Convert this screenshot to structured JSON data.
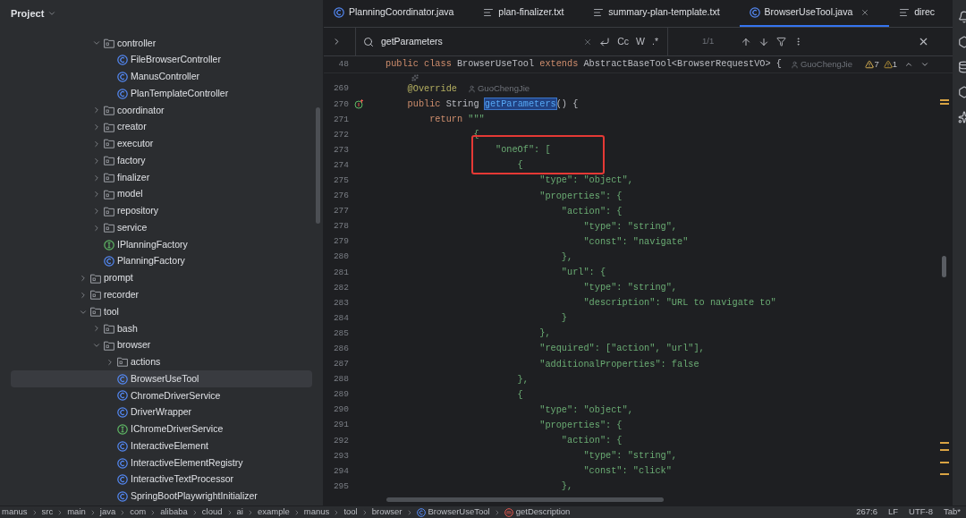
{
  "project_panel": {
    "title": "Project",
    "tree": [
      {
        "kind": "group",
        "children": [
          {
            "kind": "folder",
            "label": "controller",
            "expanded": true,
            "selected": false,
            "children": [
              {
                "kind": "class",
                "label": "FileBrowserController",
                "selected": false
              },
              {
                "kind": "class",
                "label": "ManusController",
                "selected": false
              },
              {
                "kind": "class",
                "label": "PlanTemplateController",
                "selected": false
              }
            ]
          },
          {
            "kind": "folder",
            "label": "coordinator",
            "expanded": false,
            "selected": false
          },
          {
            "kind": "folder",
            "label": "creator",
            "expanded": false,
            "selected": false
          },
          {
            "kind": "folder",
            "label": "executor",
            "expanded": false,
            "selected": false
          },
          {
            "kind": "folder",
            "label": "factory",
            "expanded": false,
            "selected": false
          },
          {
            "kind": "folder",
            "label": "finalizer",
            "expanded": false,
            "selected": false
          },
          {
            "kind": "folder",
            "label": "model",
            "expanded": false,
            "selected": false
          },
          {
            "kind": "folder",
            "label": "repository",
            "expanded": false,
            "selected": false
          },
          {
            "kind": "folder",
            "label": "service",
            "expanded": false,
            "selected": false
          },
          {
            "kind": "interface",
            "label": "IPlanningFactory",
            "selected": false
          },
          {
            "kind": "class",
            "label": "PlanningFactory",
            "selected": false
          }
        ]
      },
      {
        "kind": "folder",
        "label": "prompt",
        "expanded": false,
        "selected": false
      },
      {
        "kind": "folder",
        "label": "recorder",
        "expanded": false,
        "selected": false
      },
      {
        "kind": "folder",
        "label": "tool",
        "expanded": true,
        "selected": false,
        "children": [
          {
            "kind": "folder",
            "label": "bash",
            "expanded": false,
            "selected": false
          },
          {
            "kind": "folder",
            "label": "browser",
            "expanded": true,
            "selected": false,
            "children": [
              {
                "kind": "folder",
                "label": "actions",
                "expanded": false,
                "selected": false
              },
              {
                "kind": "class",
                "label": "BrowserUseTool",
                "selected": true
              },
              {
                "kind": "class",
                "label": "ChromeDriverService",
                "selected": false
              },
              {
                "kind": "class",
                "label": "DriverWrapper",
                "selected": false
              },
              {
                "kind": "interface",
                "label": "IChromeDriverService",
                "selected": false
              },
              {
                "kind": "class",
                "label": "InteractiveElement",
                "selected": false
              },
              {
                "kind": "class",
                "label": "InteractiveElementRegistry",
                "selected": false
              },
              {
                "kind": "class",
                "label": "InteractiveTextProcessor",
                "selected": false
              },
              {
                "kind": "class",
                "label": "SpringBootPlaywrightInitializer",
                "selected": false
              }
            ]
          }
        ]
      }
    ]
  },
  "editor": {
    "tabs": [
      {
        "kind": "class",
        "label": "PlanningCoordinator.java",
        "selected": false
      },
      {
        "kind": "text",
        "label": "plan-finalizer.txt",
        "selected": false
      },
      {
        "kind": "text",
        "label": "summary-plan-template.txt",
        "selected": false
      },
      {
        "kind": "class",
        "label": "BrowserUseTool.java",
        "selected": true
      },
      {
        "kind": "text",
        "label": "direc",
        "selected": false
      }
    ],
    "find": {
      "value": "getParameters",
      "case_label": "Cc",
      "word_label": "W",
      "regex_label": ".*",
      "count": "1/1"
    },
    "sticky_line": {
      "number": "48",
      "segments": [
        {
          "kind": "keyword",
          "text": "public class "
        },
        {
          "kind": "plain",
          "text": "BrowserUseTool "
        },
        {
          "kind": "keyword",
          "text": "extends "
        },
        {
          "kind": "plain",
          "text": "AbstractBaseTool<BrowserRequestVO> {"
        }
      ],
      "author": "GuoChengJie",
      "warnings": "7",
      "weak_warnings": "1"
    },
    "lines": [
      {
        "number": "269",
        "author": "GuoChengJie",
        "segments": [
          {
            "kind": "annotation",
            "text": "    @Override"
          }
        ]
      },
      {
        "number": "270",
        "gutter_icon": true,
        "segments": [
          {
            "kind": "keyword",
            "text": "    public "
          },
          {
            "kind": "plain",
            "text": "String "
          },
          {
            "kind": "match",
            "text": "getParameters"
          },
          {
            "kind": "plain",
            "text": "() {"
          }
        ]
      },
      {
        "number": "271",
        "segments": [
          {
            "kind": "keyword",
            "text": "        return "
          },
          {
            "kind": "string",
            "text": "\"\"\""
          }
        ]
      },
      {
        "number": "272",
        "segments": [
          {
            "kind": "string",
            "text": "                {"
          }
        ]
      },
      {
        "number": "273",
        "segments": [
          {
            "kind": "string",
            "text": "                    \"oneOf\": ["
          }
        ]
      },
      {
        "number": "274",
        "segments": [
          {
            "kind": "string",
            "text": "                        {"
          }
        ]
      },
      {
        "number": "275",
        "segments": [
          {
            "kind": "string",
            "text": "                            \"type\": \"object\","
          }
        ]
      },
      {
        "number": "276",
        "segments": [
          {
            "kind": "string",
            "text": "                            \"properties\": {"
          }
        ]
      },
      {
        "number": "277",
        "segments": [
          {
            "kind": "string",
            "text": "                                \"action\": {"
          }
        ]
      },
      {
        "number": "278",
        "segments": [
          {
            "kind": "string",
            "text": "                                    \"type\": \"string\","
          }
        ]
      },
      {
        "number": "279",
        "segments": [
          {
            "kind": "string",
            "text": "                                    \"const\": \"navigate\""
          }
        ]
      },
      {
        "number": "280",
        "segments": [
          {
            "kind": "string",
            "text": "                                },"
          }
        ]
      },
      {
        "number": "281",
        "segments": [
          {
            "kind": "string",
            "text": "                                \"url\": {"
          }
        ]
      },
      {
        "number": "282",
        "segments": [
          {
            "kind": "string",
            "text": "                                    \"type\": \"string\","
          }
        ]
      },
      {
        "number": "283",
        "segments": [
          {
            "kind": "string",
            "text": "                                    \"description\": \"URL to navigate to\""
          }
        ]
      },
      {
        "number": "284",
        "segments": [
          {
            "kind": "string",
            "text": "                                }"
          }
        ]
      },
      {
        "number": "285",
        "segments": [
          {
            "kind": "string",
            "text": "                            },"
          }
        ]
      },
      {
        "number": "286",
        "segments": [
          {
            "kind": "string",
            "text": "                            \"required\": [\"action\", \"url\"],"
          }
        ]
      },
      {
        "number": "287",
        "segments": [
          {
            "kind": "string",
            "text": "                            \"additionalProperties\": false"
          }
        ]
      },
      {
        "number": "288",
        "segments": [
          {
            "kind": "string",
            "text": "                        },"
          }
        ]
      },
      {
        "number": "289",
        "segments": [
          {
            "kind": "string",
            "text": "                        {"
          }
        ]
      },
      {
        "number": "290",
        "segments": [
          {
            "kind": "string",
            "text": "                            \"type\": \"object\","
          }
        ]
      },
      {
        "number": "291",
        "segments": [
          {
            "kind": "string",
            "text": "                            \"properties\": {"
          }
        ]
      },
      {
        "number": "292",
        "segments": [
          {
            "kind": "string",
            "text": "                                \"action\": {"
          }
        ]
      },
      {
        "number": "293",
        "segments": [
          {
            "kind": "string",
            "text": "                                    \"type\": \"string\","
          }
        ]
      },
      {
        "number": "294",
        "segments": [
          {
            "kind": "string",
            "text": "                                    \"const\": \"click\""
          }
        ]
      },
      {
        "number": "295",
        "segments": [
          {
            "kind": "string",
            "text": "                                },"
          }
        ]
      }
    ]
  },
  "status_bar": {
    "breadcrumbs": [
      {
        "kind": "plain",
        "label": "manus"
      },
      {
        "kind": "plain",
        "label": "src"
      },
      {
        "kind": "plain",
        "label": "main"
      },
      {
        "kind": "plain",
        "label": "java"
      },
      {
        "kind": "plain",
        "label": "com"
      },
      {
        "kind": "plain",
        "label": "alibaba"
      },
      {
        "kind": "plain",
        "label": "cloud"
      },
      {
        "kind": "plain",
        "label": "ai"
      },
      {
        "kind": "plain",
        "label": "example"
      },
      {
        "kind": "plain",
        "label": "manus"
      },
      {
        "kind": "plain",
        "label": "tool"
      },
      {
        "kind": "plain",
        "label": "browser"
      },
      {
        "kind": "class",
        "label": "BrowserUseTool"
      },
      {
        "kind": "method",
        "label": "getDescription"
      }
    ],
    "position": "267:6",
    "line_ending": "LF",
    "encoding": "UTF-8",
    "indent": "Tab*"
  }
}
